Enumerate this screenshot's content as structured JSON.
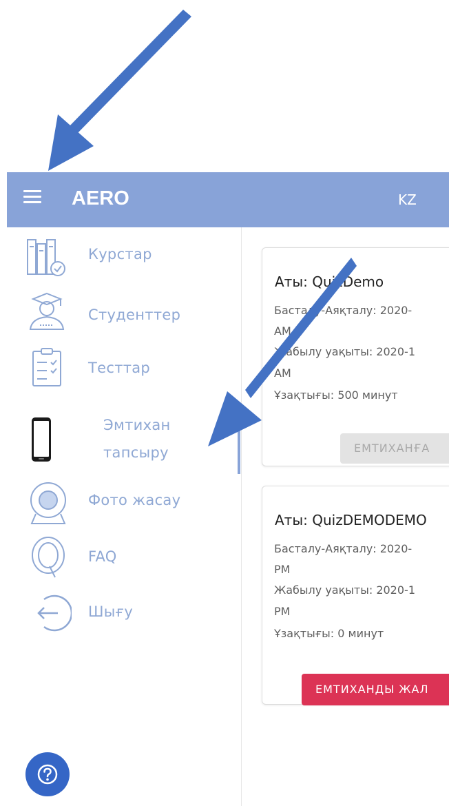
{
  "app": {
    "brand": "AERO",
    "language": "KZ"
  },
  "sidebar": {
    "items": [
      {
        "label": "Курстар",
        "icon": "courses-icon"
      },
      {
        "label": "Студенттер",
        "icon": "students-icon"
      },
      {
        "label": "Тесттар",
        "icon": "tests-icon"
      },
      {
        "label_line1": "Эмтихан",
        "label_line2": "тапсыру",
        "icon": "tablet-icon",
        "active": true
      },
      {
        "label": "Фото жасау",
        "icon": "webcam-icon"
      },
      {
        "label": "FAQ",
        "icon": "faq-icon"
      },
      {
        "label": "Шығу",
        "icon": "logout-icon"
      }
    ],
    "help_icon": "help-icon"
  },
  "quizzes": [
    {
      "title": "Аты: QuizDemo",
      "start_end": "Басталу-Аяқталу: 2020-",
      "start_end_suffix": "AM",
      "close_time": "Жабылу уақыты: 2020-1",
      "close_time_suffix": "AM",
      "duration": "Ұзақтығы: 500 минут",
      "button": "ЕМТИХАНҒА",
      "button_state": "disabled"
    },
    {
      "title": "Аты: QuizDEMODEMO",
      "start_end": "Басталу-Аяқталу: 2020-",
      "start_end_suffix": "PM",
      "close_time": "Жабылу уақыты: 2020-1",
      "close_time_suffix": "PM",
      "duration": "Ұзақтығы: 0 минут",
      "button": "ЕМТИХАНДЫ ЖАЛ",
      "button_state": "enabled"
    }
  ],
  "colors": {
    "appbar": "#88a3d8",
    "nav_text": "#8fa8d4",
    "danger": "#dc3355",
    "help": "#3566c6",
    "annotation_arrow": "#4472c4"
  }
}
